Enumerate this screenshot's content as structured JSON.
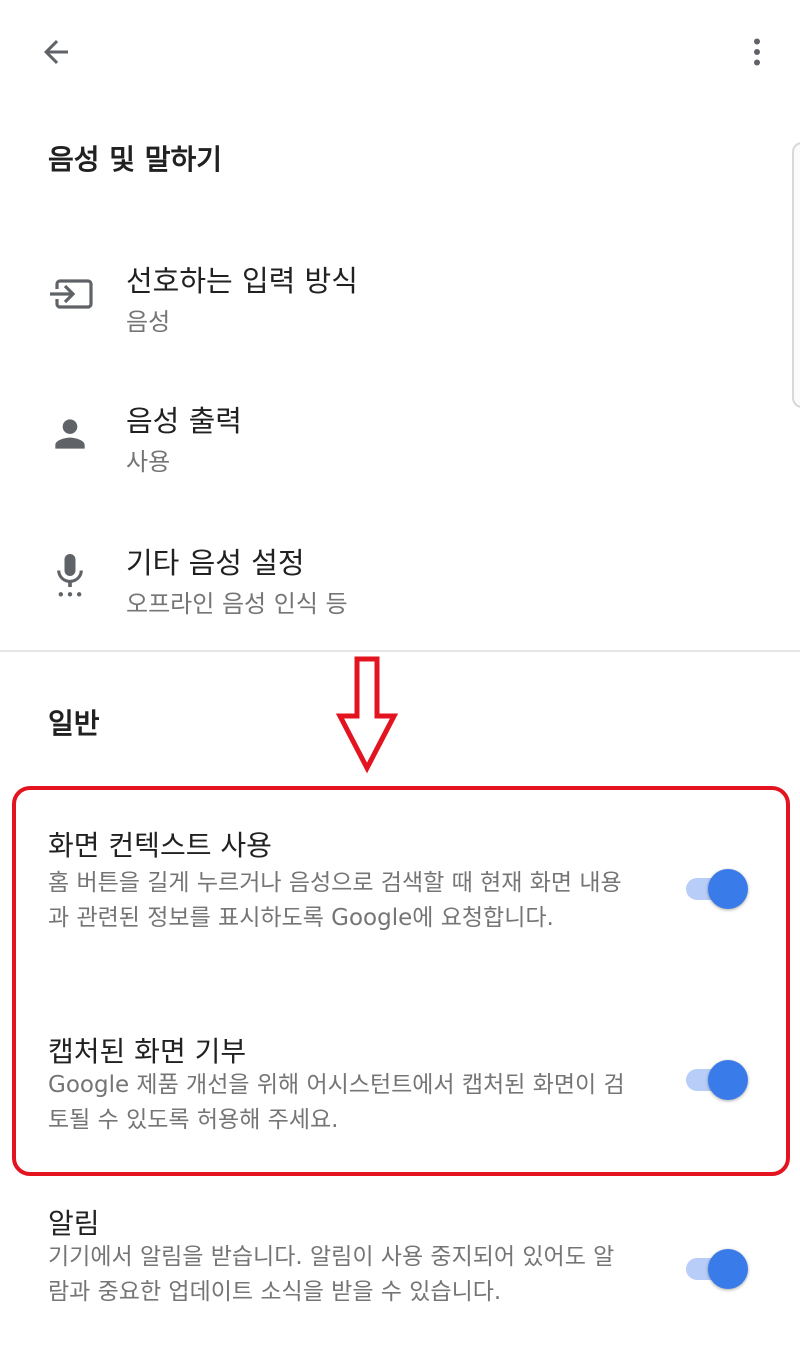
{
  "header": {
    "back_icon": "back-arrow-icon",
    "more_icon": "more-vert-icon"
  },
  "voice_section": {
    "title": "음성 및 말하기",
    "items": [
      {
        "icon": "input-method-icon",
        "title": "선호하는 입력 방식",
        "subtitle": "음성"
      },
      {
        "icon": "person-icon",
        "title": "음성 출력",
        "subtitle": "사용"
      },
      {
        "icon": "microphone-icon",
        "title": "기타 음성 설정",
        "subtitle": "오프라인 음성 인식 등"
      }
    ]
  },
  "general_section": {
    "title": "일반",
    "settings": [
      {
        "title": "화면 컨텍스트 사용",
        "description": "홈 버튼을 길게 누르거나 음성으로 검색할 때 현재 화면 내용과 관련된 정보를 표시하도록 Google에 요청합니다.",
        "enabled": true
      },
      {
        "title": "캡처된 화면 기부",
        "description": "Google 제품 개선을 위해 어시스턴트에서 캡처된 화면이 검토될 수 있도록 허용해 주세요.",
        "enabled": true
      },
      {
        "title": "알림",
        "description": "기기에서 알림을 받습니다. 알림이 사용 중지되어 있어도 알람과 중요한 업데이트 소식을 받을 수 있습니다.",
        "enabled": true
      }
    ]
  },
  "colors": {
    "accent": "#3a7bea",
    "track": "#b8cdf8",
    "annotation": "#e3141f",
    "secondary_text": "#757575"
  }
}
